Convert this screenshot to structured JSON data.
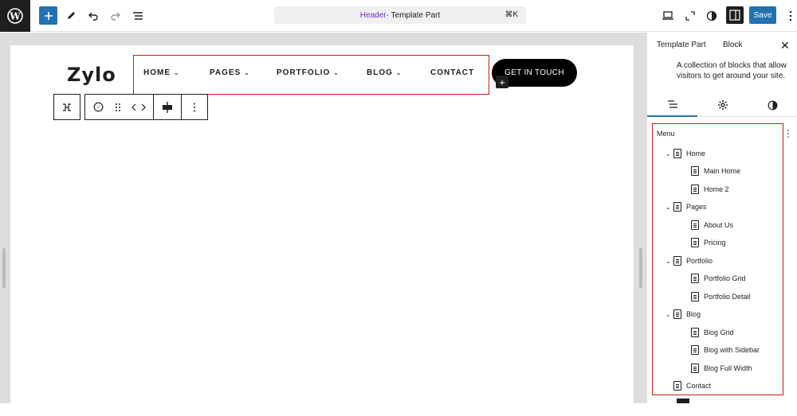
{
  "topbar": {
    "command_prefix": "Header",
    "command_suffix": " · Template Part",
    "shortcut": "⌘K",
    "save_label": "Save"
  },
  "site": {
    "logo": "Zylo",
    "nav": [
      "HOME",
      "PAGES",
      "PORTFOLIO",
      "BLOG",
      "CONTACT"
    ],
    "cta": "GET IN TOUCH"
  },
  "panel": {
    "tabs": [
      "Template Part",
      "Block"
    ],
    "description": "A collection of blocks that allow visitors to get around your site.",
    "tree_title": "Menu",
    "items": [
      {
        "label": "Home",
        "level": 0,
        "expand": true
      },
      {
        "label": "Main Home",
        "level": 1
      },
      {
        "label": "Home 2",
        "level": 1
      },
      {
        "label": "Pages",
        "level": 0,
        "expand": true
      },
      {
        "label": "About Us",
        "level": 1
      },
      {
        "label": "Pricing",
        "level": 1
      },
      {
        "label": "Portfolio",
        "level": 0,
        "expand": true
      },
      {
        "label": "Portfolio Grid",
        "level": 1
      },
      {
        "label": "Portfolio Detail",
        "level": 1
      },
      {
        "label": "Blog",
        "level": 0,
        "expand": true
      },
      {
        "label": "Blog Grid",
        "level": 1
      },
      {
        "label": "Blog with Sidebar",
        "level": 1
      },
      {
        "label": "Blog Full Width",
        "level": 1
      },
      {
        "label": "Contact",
        "level": 0,
        "expand": false
      }
    ]
  },
  "colors": {
    "accent": "#2271b1",
    "selection": "#cc1818",
    "dark": "#1e1e1e"
  }
}
